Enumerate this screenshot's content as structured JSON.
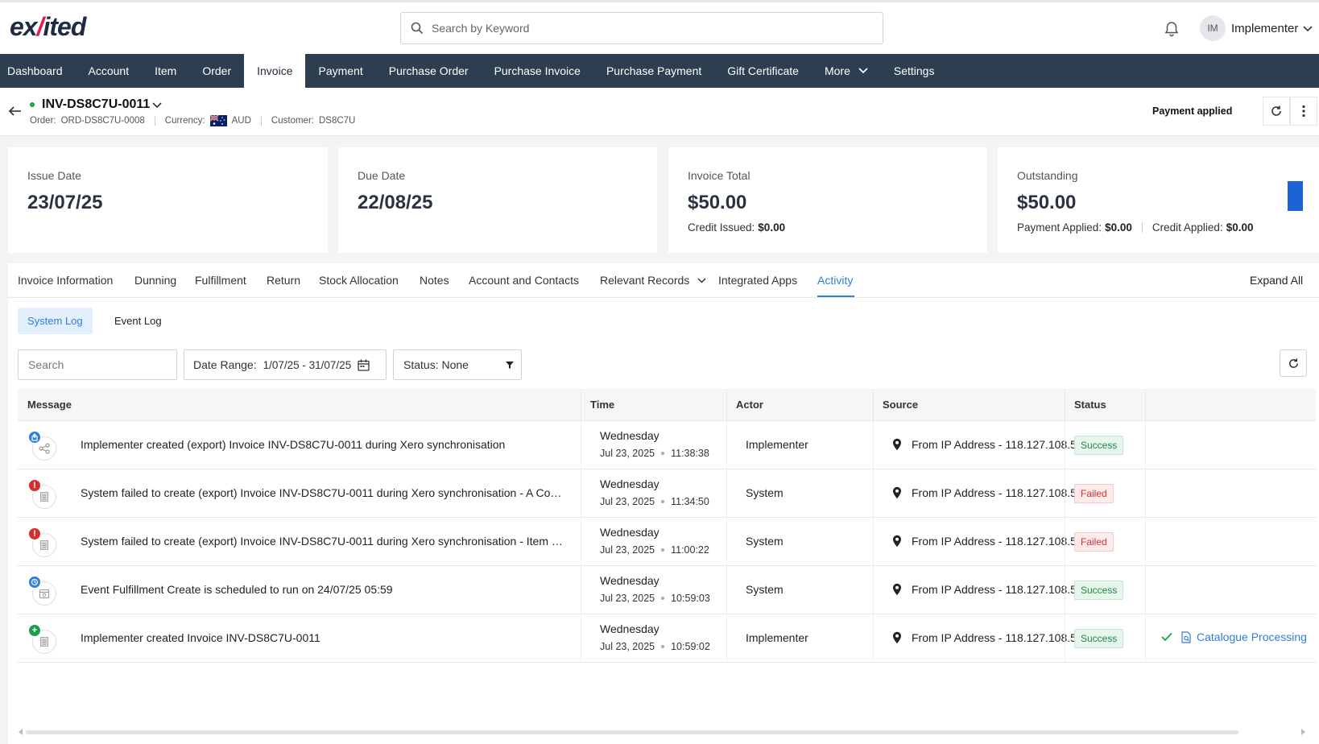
{
  "header": {
    "logo_text_a": "ex",
    "logo_text_slash": "/",
    "logo_text_b": "ited",
    "search_placeholder": "Search by Keyword",
    "avatar_initials": "IM",
    "user_name": "Implementer"
  },
  "nav": {
    "items": [
      "Dashboard",
      "Account",
      "Item",
      "Order",
      "Invoice",
      "Payment",
      "Purchase Order",
      "Purchase Invoice",
      "Purchase Payment",
      "Gift Certificate",
      "More",
      "Settings"
    ],
    "active": "Invoice"
  },
  "invoice": {
    "title": "INV-DS8C7U-0011",
    "order_label": "Order:",
    "order_value": "ORD-DS8C7U-0008",
    "currency_label": "Currency:",
    "currency_value": "AUD",
    "customer_label": "Customer:",
    "customer_value": "DS8C7U",
    "status": "Payment applied",
    "status_dot_color": "#16a34a"
  },
  "cards": {
    "issue": {
      "label": "Issue Date",
      "value": "23/07/25"
    },
    "due": {
      "label": "Due Date",
      "value": "22/08/25"
    },
    "total": {
      "label": "Invoice Total",
      "value": "$50.00",
      "credit_issued_label": "Credit Issued:",
      "credit_issued_value": "$0.00"
    },
    "outstanding": {
      "label": "Outstanding",
      "value": "$50.00",
      "payment_applied_label": "Payment Applied:",
      "payment_applied_value": "$0.00",
      "credit_applied_label": "Credit Applied:",
      "credit_applied_value": "$0.00"
    }
  },
  "tabs": {
    "items": [
      "Invoice Information",
      "Dunning",
      "Fulfillment",
      "Return",
      "Stock Allocation",
      "Notes",
      "Account and Contacts",
      "Relevant Records",
      "Integrated Apps",
      "Activity"
    ],
    "active": "Activity",
    "expand_all": "Expand All"
  },
  "log_toggle": {
    "system": "System Log",
    "event": "Event Log",
    "active": "System Log"
  },
  "filters": {
    "search_placeholder": "Search",
    "date_range_label": "Date Range:",
    "date_range_value": "1/07/25 - 31/07/25",
    "status_label": "Status: None"
  },
  "table": {
    "columns": [
      "Message",
      "Time",
      "Actor",
      "Source",
      "Status"
    ],
    "rows": [
      {
        "icon": "share-icon",
        "badge": "export-badge",
        "badge_color": "#2f7fd6",
        "message": "Implementer created (export) Invoice INV-DS8C7U-0011 during Xero synchronisation",
        "day": "Wednesday",
        "date": "Jul 23, 2025",
        "time": "11:38:38",
        "actor": "Implementer",
        "source": "From IP Address - 118.127.108.5",
        "status": "Success",
        "extra": ""
      },
      {
        "icon": "document-icon",
        "badge": "error-badge",
        "badge_color": "#d32f2f",
        "message": "System failed to create (export) Invoice INV-DS8C7U-0011 during Xero synchronisation - A Contact…",
        "day": "Wednesday",
        "date": "Jul 23, 2025",
        "time": "11:34:50",
        "actor": "System",
        "source": "From IP Address - 118.127.108.5",
        "status": "Failed",
        "extra": ""
      },
      {
        "icon": "document-icon",
        "badge": "error-badge",
        "badge_color": "#d32f2f",
        "message": "System failed to create (export) Invoice INV-DS8C7U-0011 during Xero synchronisation - Item code…",
        "day": "Wednesday",
        "date": "Jul 23, 2025",
        "time": "11:00:22",
        "actor": "System",
        "source": "From IP Address - 118.127.108.5",
        "status": "Failed",
        "extra": ""
      },
      {
        "icon": "calendar-icon",
        "badge": "schedule-badge",
        "badge_color": "#2f7fd6",
        "message": "Event Fulfillment Create is scheduled to run on 24/07/25 05:59",
        "day": "Wednesday",
        "date": "Jul 23, 2025",
        "time": "10:59:03",
        "actor": "System",
        "source": "From IP Address - 118.127.108.5",
        "status": "Success",
        "extra": ""
      },
      {
        "icon": "document-icon",
        "badge": "add-badge",
        "badge_color": "#1e9e4a",
        "message": "Implementer created Invoice INV-DS8C7U-0011",
        "day": "Wednesday",
        "date": "Jul 23, 2025",
        "time": "10:59:02",
        "actor": "Implementer",
        "source": "From IP Address - 118.127.108.5",
        "status": "Success",
        "extra": "Catalogue Processing"
      }
    ]
  },
  "colors": {
    "nav_bg": "#2d3e50",
    "accent": "#2f7fd6",
    "outstanding_bar": "#1a64d6"
  }
}
